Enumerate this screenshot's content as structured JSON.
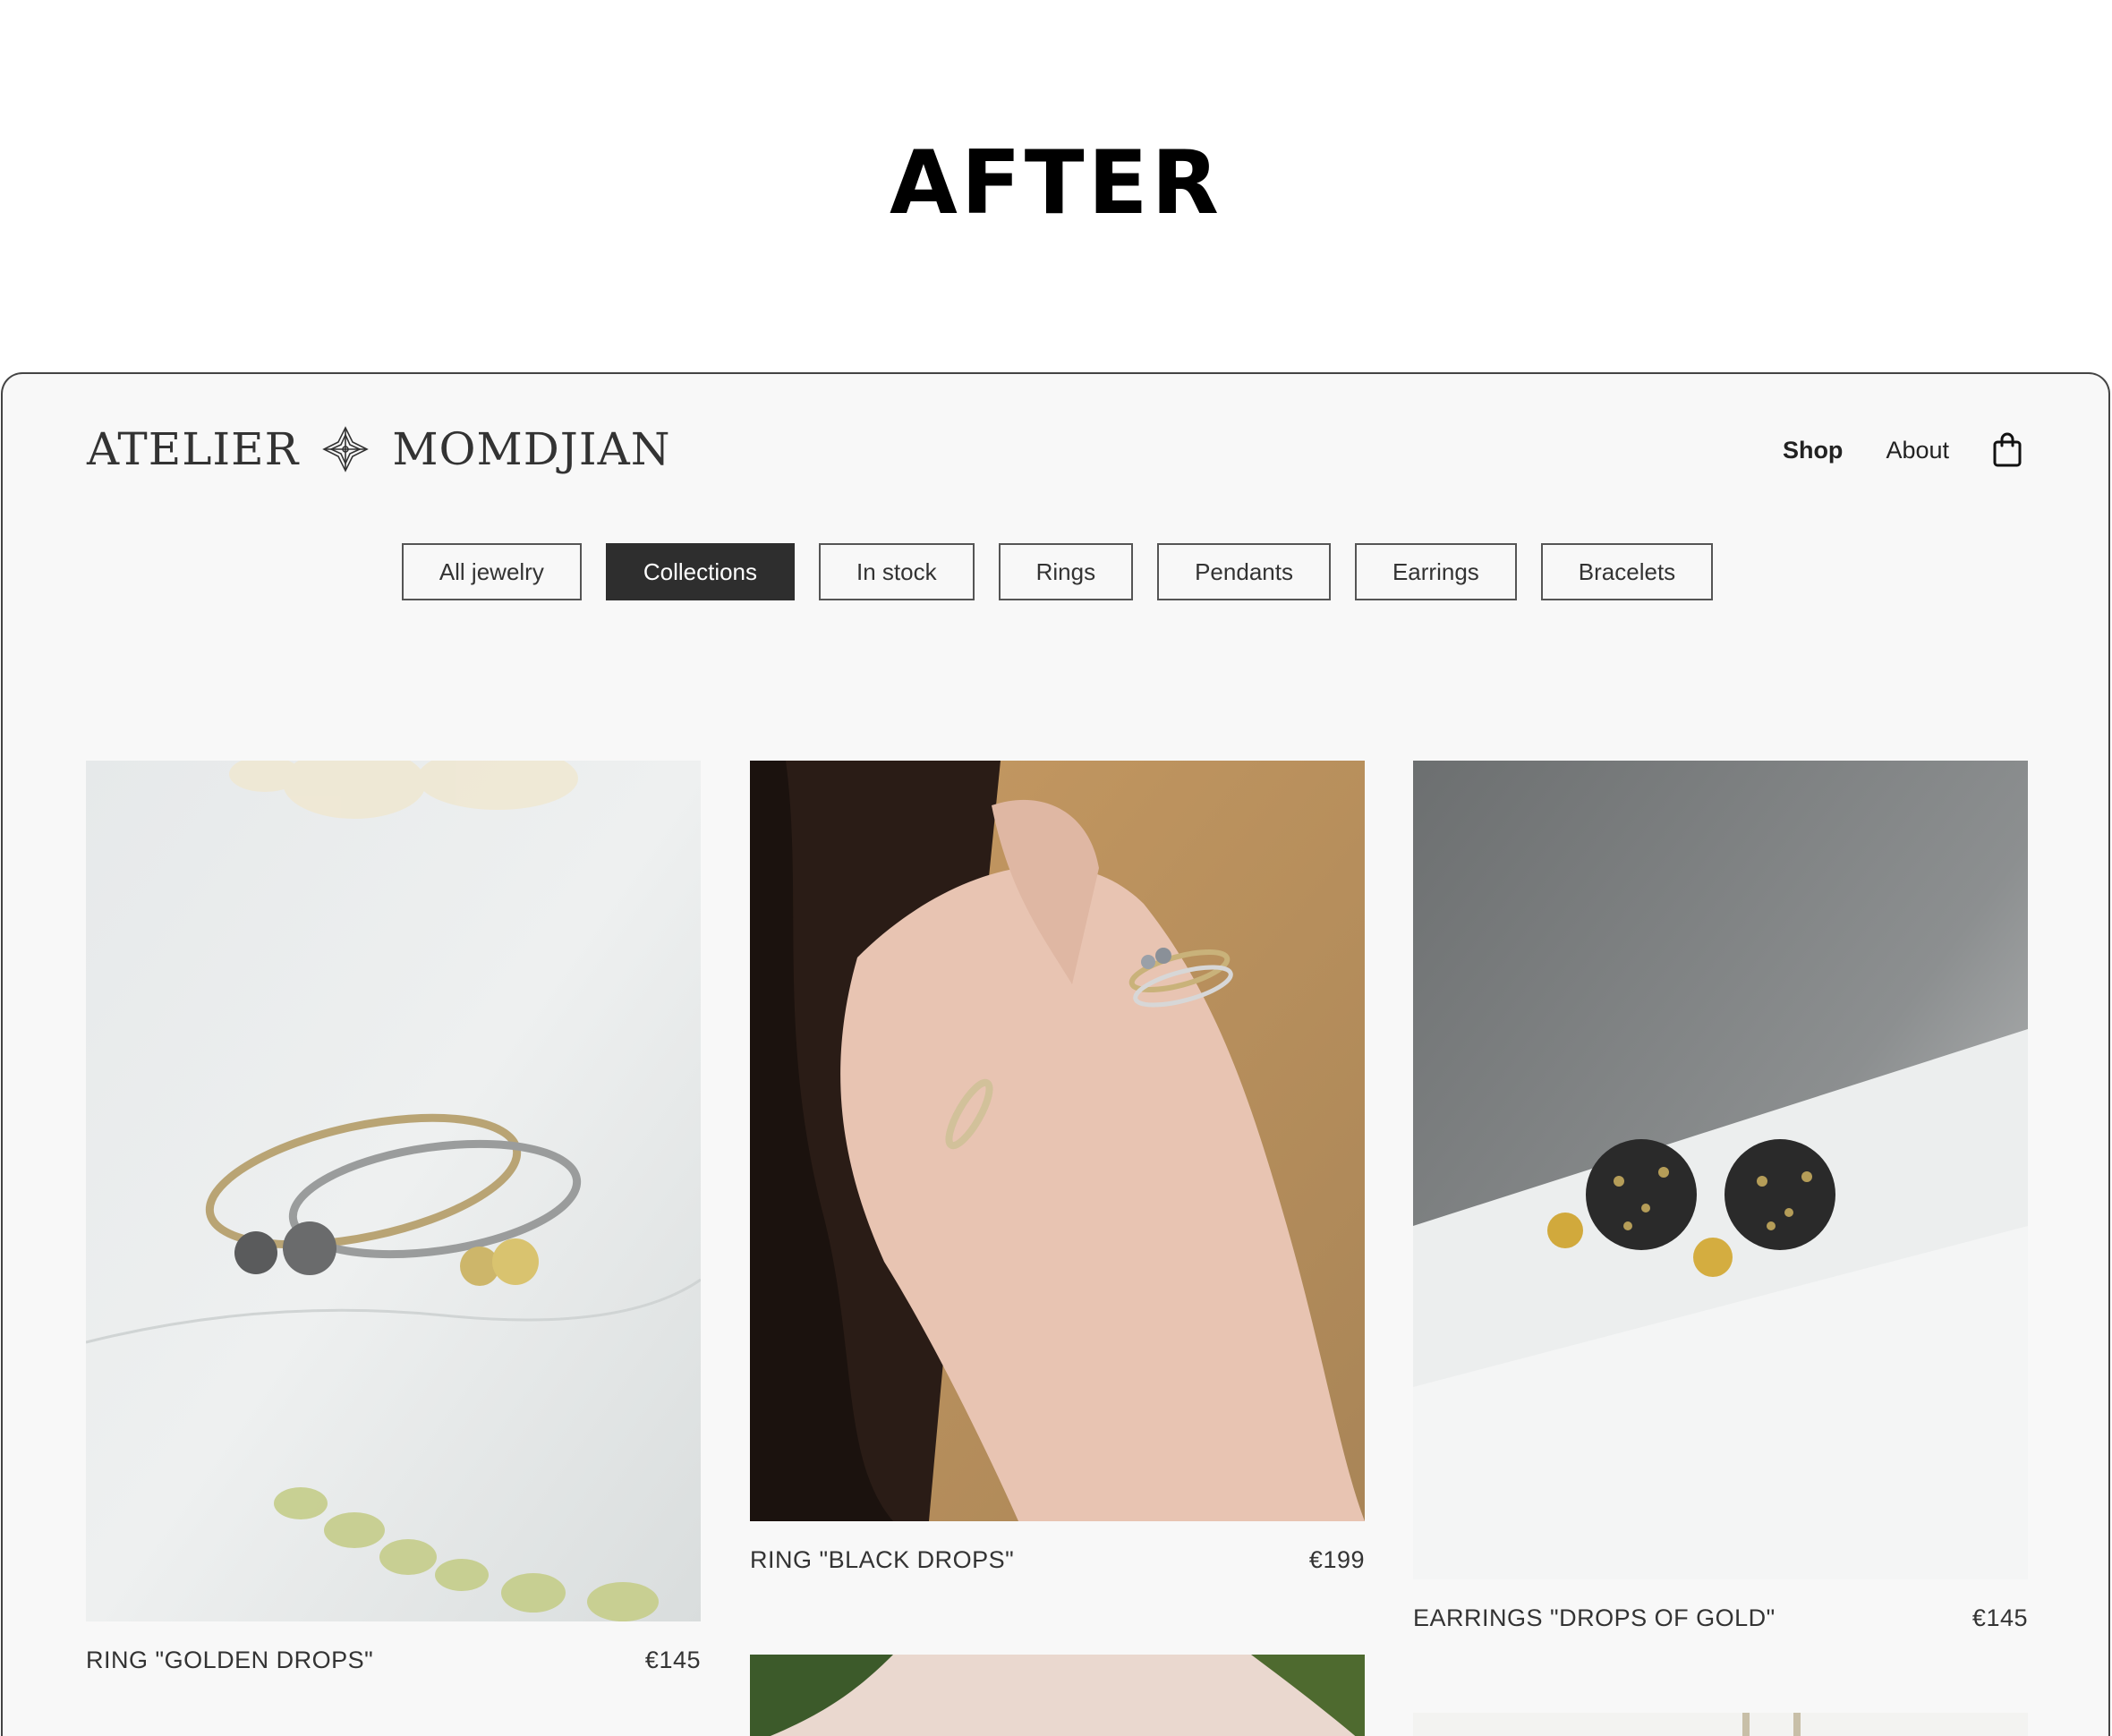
{
  "heading": "AFTER",
  "brand": {
    "name_left": "ATELIER",
    "name_right": "MOMDJIAN",
    "logo_icon": "diamond-ornament-icon"
  },
  "nav": {
    "shop": "Shop",
    "about": "About",
    "cart_icon": "shopping-bag-icon"
  },
  "filters": [
    {
      "label": "All jewelry",
      "active": false
    },
    {
      "label": "Collections",
      "active": true
    },
    {
      "label": "In stock",
      "active": false
    },
    {
      "label": "Rings",
      "active": false
    },
    {
      "label": "Pendants",
      "active": false
    },
    {
      "label": "Earrings",
      "active": false
    },
    {
      "label": "Bracelets",
      "active": false
    }
  ],
  "products": [
    {
      "name": "RING \"GOLDEN DROPS\"",
      "price": "€145"
    },
    {
      "name": "RING \"BLACK DROPS\"",
      "price": "€199"
    },
    {
      "name": "EARRINGS \"DROPS OF GOLD\"",
      "price": "€145"
    }
  ],
  "colors": {
    "page_bg": "#f8f8f8",
    "active_filter_bg": "#2e2e2e",
    "text": "#333333"
  }
}
